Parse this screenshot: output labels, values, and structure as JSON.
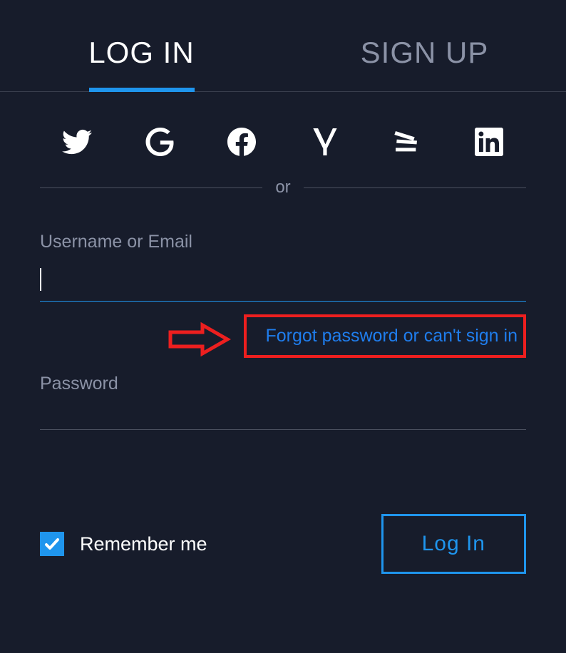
{
  "tabs": {
    "login": "LOG IN",
    "signup": "SIGN UP"
  },
  "divider": "or",
  "fields": {
    "username_label": "Username or Email",
    "password_label": "Password"
  },
  "forgot_link": "Forgot password or can't sign in",
  "remember_label": "Remember me",
  "login_button": "Log In",
  "social": {
    "twitter": "twitter-icon",
    "google": "google-icon",
    "facebook": "facebook-icon",
    "yandex": "yandex-icon",
    "stackoverflow": "stackoverflow-icon",
    "linkedin": "linkedin-icon"
  }
}
